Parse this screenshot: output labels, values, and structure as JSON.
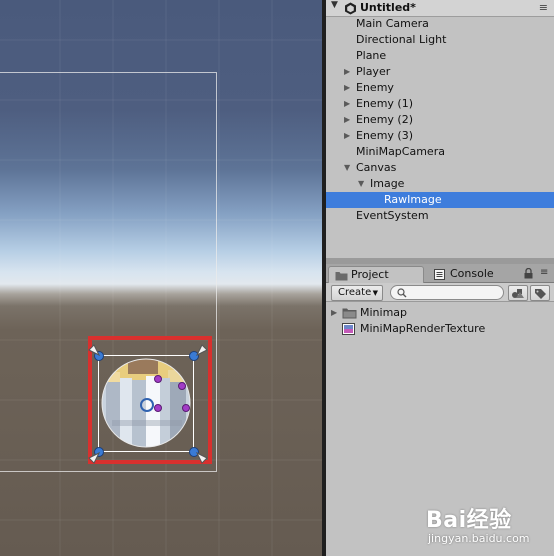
{
  "hierarchy": {
    "scene_title": "Untitled*",
    "menu_glyph": "≡",
    "items": [
      {
        "label": "Main Camera",
        "depth": 0,
        "expandable": false
      },
      {
        "label": "Directional Light",
        "depth": 0,
        "expandable": false
      },
      {
        "label": "Plane",
        "depth": 0,
        "expandable": false
      },
      {
        "label": "Player",
        "depth": 0,
        "expandable": true,
        "expanded": false
      },
      {
        "label": "Enemy",
        "depth": 0,
        "expandable": true,
        "expanded": false
      },
      {
        "label": "Enemy (1)",
        "depth": 0,
        "expandable": true,
        "expanded": false
      },
      {
        "label": "Enemy (2)",
        "depth": 0,
        "expandable": true,
        "expanded": false
      },
      {
        "label": "Enemy (3)",
        "depth": 0,
        "expandable": true,
        "expanded": false
      },
      {
        "label": "MiniMapCamera",
        "depth": 0,
        "expandable": false
      },
      {
        "label": "Canvas",
        "depth": 0,
        "expandable": true,
        "expanded": true
      },
      {
        "label": "Image",
        "depth": 1,
        "expandable": true,
        "expanded": true
      },
      {
        "label": "RawImage",
        "depth": 2,
        "expandable": false,
        "selected": true
      },
      {
        "label": "EventSystem",
        "depth": 0,
        "expandable": false
      }
    ]
  },
  "project_panel": {
    "tabs": [
      {
        "label": "Project",
        "active": true,
        "icon": "folder-icon"
      },
      {
        "label": "Console",
        "active": false,
        "icon": "console-icon"
      }
    ],
    "create_label": "Create",
    "search_placeholder": "",
    "assets": [
      {
        "label": "Minimap",
        "icon": "folder-icon",
        "expandable": true
      },
      {
        "label": "MiniMapRenderTexture",
        "icon": "render-texture-icon",
        "expandable": false
      }
    ]
  },
  "watermark": {
    "brand": "Bai经验",
    "url": "jingyan.baidu.com"
  },
  "colors": {
    "selection_highlight": "#3e7ddc",
    "selection_outline": "#d9302e",
    "handle_blue": "#3a7bd5",
    "anchor_dot_purple": "#a23cc7"
  }
}
